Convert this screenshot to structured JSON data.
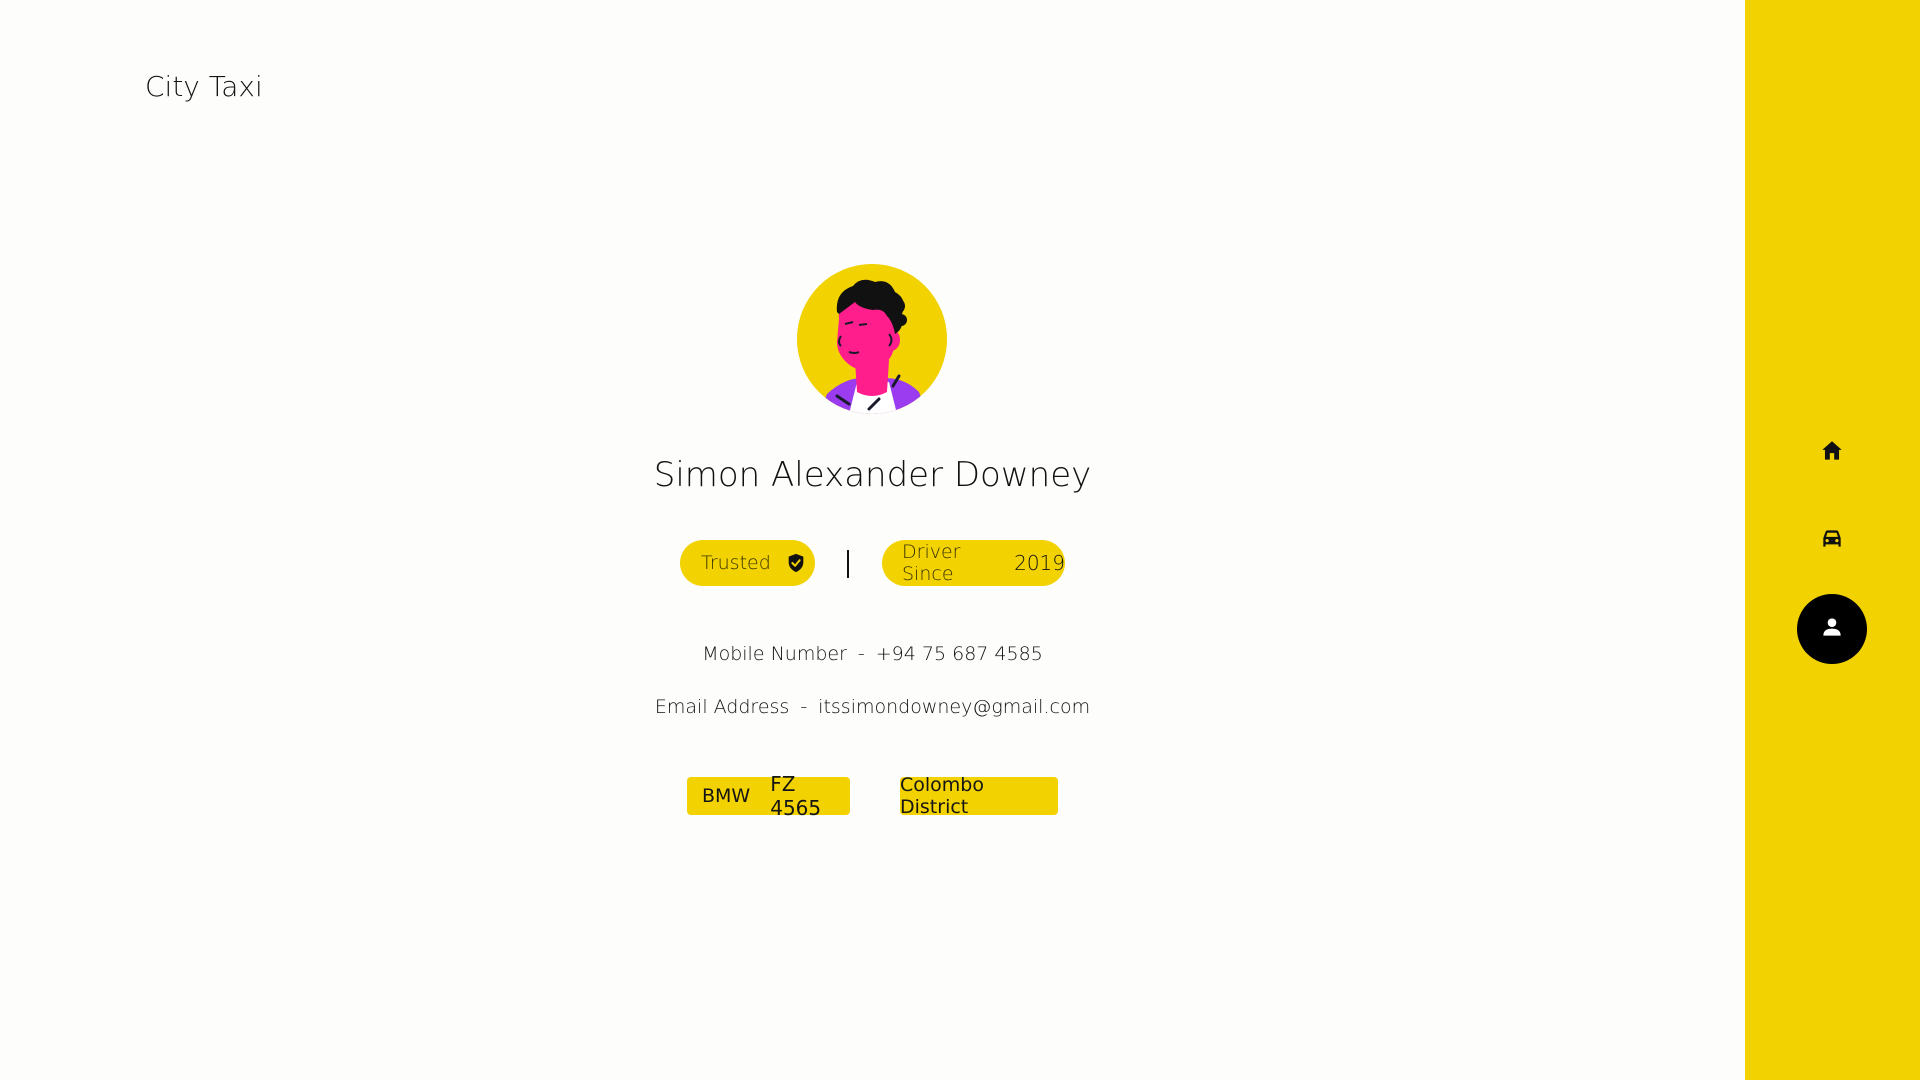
{
  "app": {
    "title": "City Taxi"
  },
  "sidebar": {
    "items": [
      {
        "icon": "home-icon",
        "label": "Home",
        "active": false
      },
      {
        "icon": "car-icon",
        "label": "Vehicle",
        "active": false
      },
      {
        "icon": "user-icon",
        "label": "Profile",
        "active": true
      }
    ]
  },
  "profile": {
    "name": "Simon Alexander Downey",
    "trusted_label": "Trusted",
    "driver_since_label": "Driver Since",
    "driver_since_year": "2019",
    "mobile_label": "Mobile Number",
    "mobile_separator": "-",
    "mobile_value": "+94 75 687 4585",
    "email_label": "Email Address",
    "email_separator": "-",
    "email_value": "itssimondowney@gmail.com",
    "vehicle_make": "BMW",
    "vehicle_plate": "FZ 4565",
    "district": "Colombo District"
  },
  "colors": {
    "accent": "#f2d200",
    "background": "#fdfdfb",
    "text": "#111111",
    "active_nav": "#000000"
  }
}
